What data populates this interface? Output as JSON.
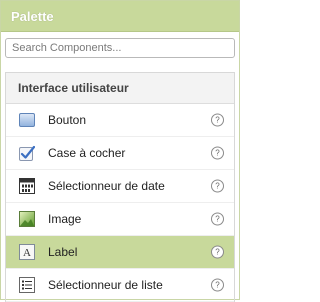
{
  "palette": {
    "title": "Palette",
    "search": {
      "placeholder": "Search Components..."
    },
    "category": {
      "title": "Interface utilisateur",
      "items": [
        {
          "label": "Bouton",
          "icon": "button-icon",
          "help": "?"
        },
        {
          "label": "Case à cocher",
          "icon": "checkbox-icon",
          "help": "?"
        },
        {
          "label": "Sélectionneur de date",
          "icon": "calendar-icon",
          "help": "?"
        },
        {
          "label": "Image",
          "icon": "image-icon",
          "help": "?"
        },
        {
          "label": "Label",
          "icon": "label-icon",
          "help": "?",
          "selected": true
        },
        {
          "label": "Sélectionneur de liste",
          "icon": "list-icon",
          "help": "?"
        }
      ]
    }
  },
  "colors": {
    "header_bg": "#c8d99b",
    "selected_bg": "#c8d99b",
    "category_bg": "#f3f3f3"
  }
}
